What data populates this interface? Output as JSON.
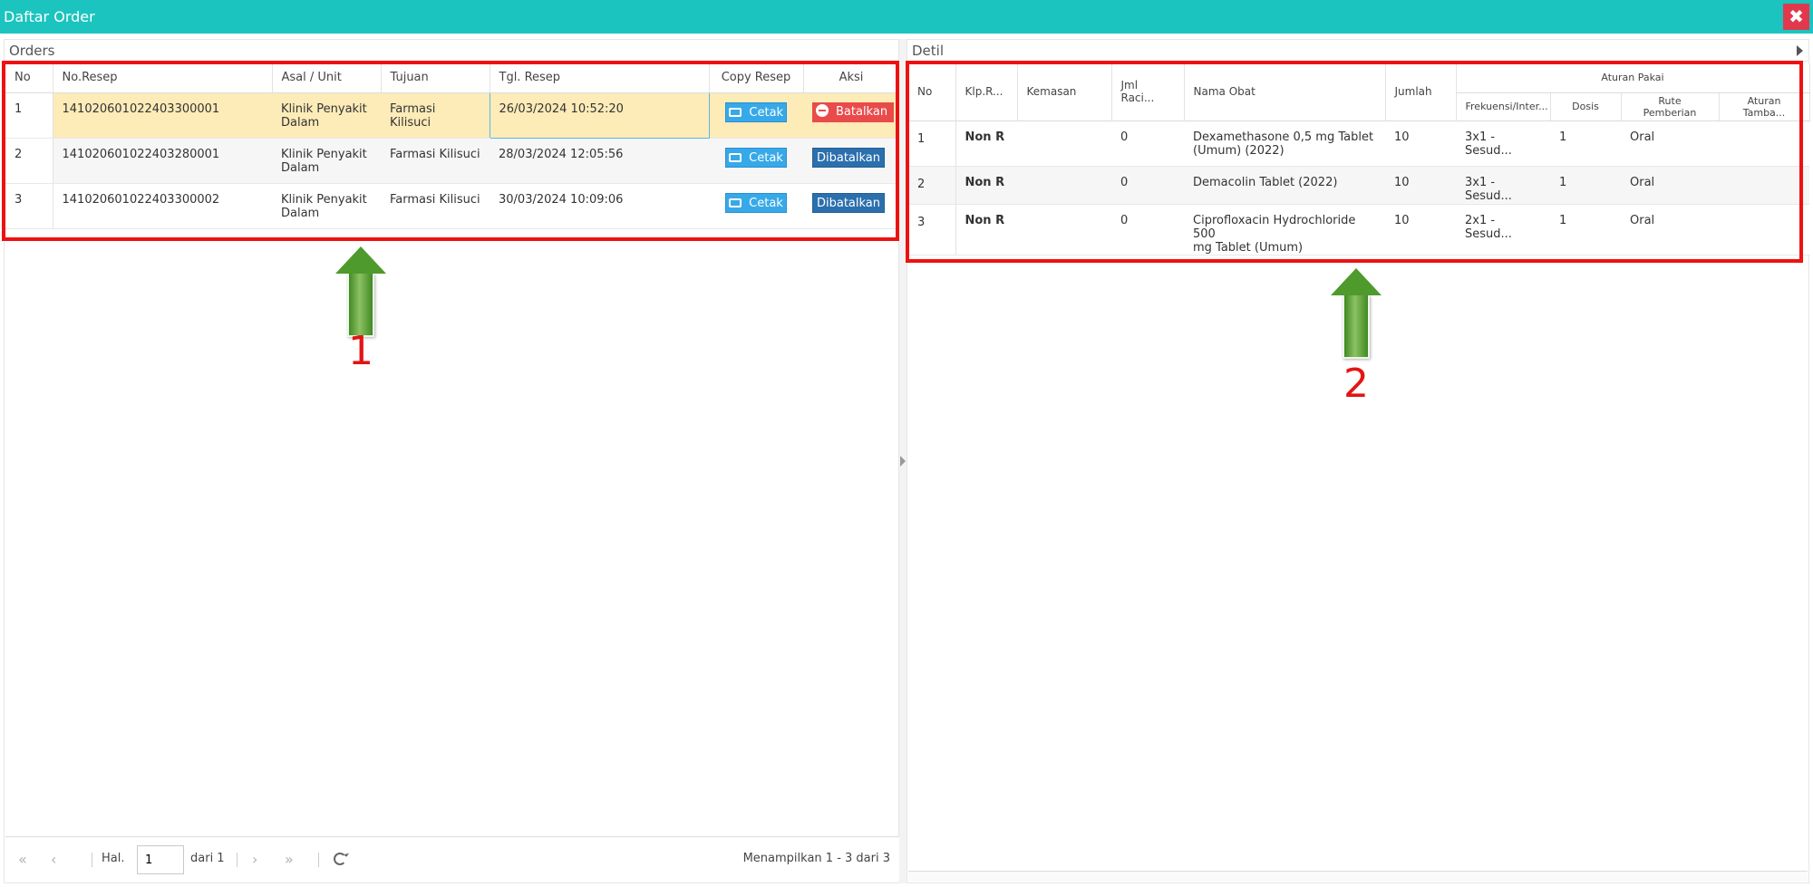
{
  "window": {
    "title": "Daftar Order",
    "close_label": "✖"
  },
  "orders_panel": {
    "title": "Orders",
    "columns": [
      "No",
      "No.Resep",
      "Asal / Unit",
      "Tujuan",
      "Tgl. Resep",
      "Copy Resep",
      "Aksi"
    ],
    "rows": [
      {
        "no": "1",
        "no_resep": "141020601022403300001",
        "asal_line1": "Klinik Penyakit",
        "asal_line2": "Dalam",
        "tujuan": "Farmasi Kilisuci",
        "tgl": "26/03/2024 10:52:20",
        "copy": "Cetak",
        "aksi": "Batalkan"
      },
      {
        "no": "2",
        "no_resep": "141020601022403280001",
        "asal_line1": "Klinik Penyakit",
        "asal_line2": "Dalam",
        "tujuan": "Farmasi Kilisuci",
        "tgl": "28/03/2024 12:05:56",
        "copy": "Cetak",
        "aksi": "Dibatalkan"
      },
      {
        "no": "3",
        "no_resep": "141020601022403300002",
        "asal_line1": "Klinik Penyakit",
        "asal_line2": "Dalam",
        "tujuan": "Farmasi Kilisuci",
        "tgl": "30/03/2024 10:09:06",
        "copy": "Cetak",
        "aksi": "Dibatalkan"
      }
    ]
  },
  "pager": {
    "hal_label": "Hal.",
    "page_value": "1",
    "dari_label": "dari 1",
    "info": "Menampilkan 1 - 3 dari 3"
  },
  "detail_panel": {
    "title": "Detil",
    "columns": {
      "no": "No",
      "klp": "Klp.R...",
      "kemasan": "Kemasan",
      "jml": "Jml Raci...",
      "nama": "Nama Obat",
      "jumlah": "Jumlah",
      "group": "Aturan Pakai",
      "frek": "Frekuensi/Inter...",
      "dosis": "Dosis",
      "rute": "Rute Pemberian",
      "tambahan": "Aturan Tamba..."
    },
    "rows": [
      {
        "no": "1",
        "klp": "Non R",
        "kemasan": "",
        "jml": "0",
        "nama_line1": "Dexamethasone 0,5 mg Tablet",
        "nama_line2": "(Umum) (2022)",
        "jumlah": "10",
        "frek": "3x1 - Sesud...",
        "dosis": "1",
        "rute": "Oral",
        "tambahan": ""
      },
      {
        "no": "2",
        "klp": "Non R",
        "kemasan": "",
        "jml": "0",
        "nama_line1": "Demacolin Tablet (2022)",
        "nama_line2": "",
        "jumlah": "10",
        "frek": "3x1 - Sesud...",
        "dosis": "1",
        "rute": "Oral",
        "tambahan": ""
      },
      {
        "no": "3",
        "klp": "Non R",
        "kemasan": "",
        "jml": "0",
        "nama_line1": "Ciprofloxacin Hydrochloride 500",
        "nama_line2": "mg Tablet (Umum)",
        "jumlah": "10",
        "frek": "2x1 - Sesud...",
        "dosis": "1",
        "rute": "Oral",
        "tambahan": ""
      }
    ]
  },
  "annotations": {
    "callout_1": "1",
    "callout_2": "2",
    "highlight_color": "#ee1111",
    "arrow_color": "#4e9a2d"
  },
  "colors": {
    "titlebar": "#1bc4be",
    "close": "#e0394e",
    "cetak": "#37a9e8",
    "batalkan": "#e94b4b",
    "dibatalkan": "#2c6fad",
    "selected_row": "#fdebb8"
  }
}
